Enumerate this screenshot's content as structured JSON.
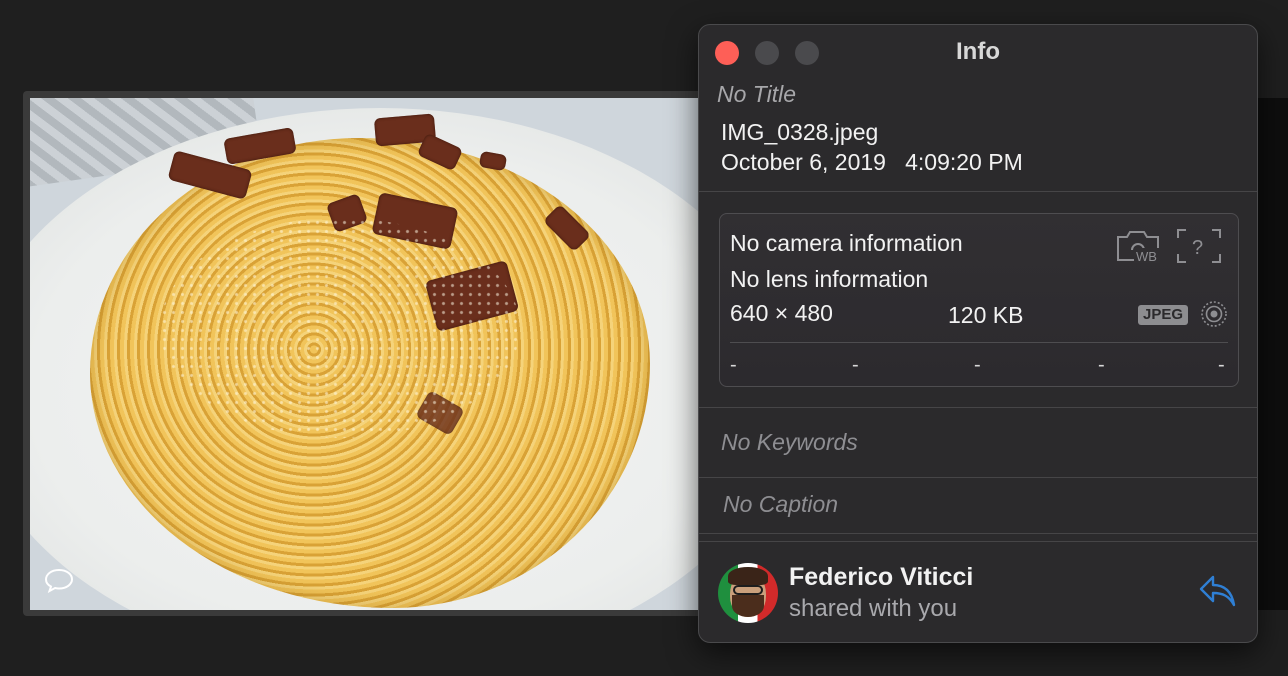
{
  "panel": {
    "title": "Info",
    "photo_title": "No Title",
    "filename": "IMG_0328.jpeg",
    "datetime": "October 6, 2019   4:09:20 PM"
  },
  "camera": {
    "camera_info": "No camera information",
    "lens_info": "No lens information",
    "dimensions": "640 × 480",
    "file_size": "120 KB",
    "format_badge": "JPEG",
    "exif_values": [
      "-",
      "-",
      "-",
      "-",
      "-"
    ],
    "icons": [
      "white-balance-camera-icon",
      "unknown-metering-icon",
      "live-photo-icon"
    ]
  },
  "metadata": {
    "keywords": "No Keywords",
    "caption": "No Caption"
  },
  "shared": {
    "name": "Federico Viticci",
    "status": "shared with you",
    "accent_color": "#2f7fd4"
  },
  "colors": {
    "close": "#fe5f57",
    "panel_bg": "#2b2a2c"
  }
}
